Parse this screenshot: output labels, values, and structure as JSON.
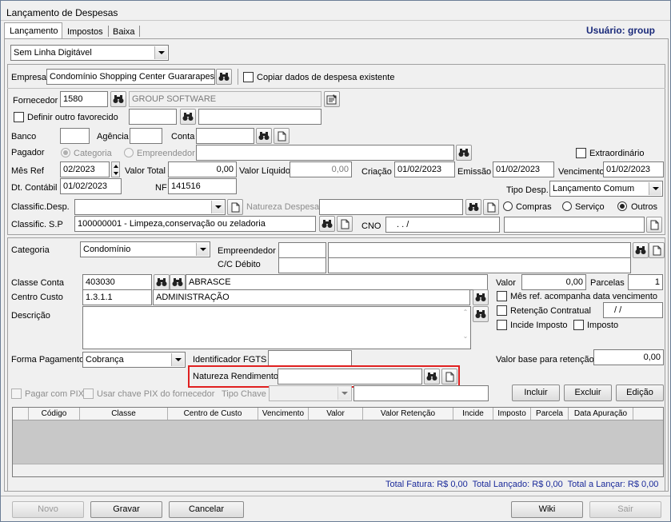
{
  "window": {
    "title": "Lançamento de Despesas"
  },
  "tabs": [
    {
      "label": "Lançamento"
    },
    {
      "label": "Impostos"
    },
    {
      "label": "Baixa"
    }
  ],
  "user": "Usuário: group",
  "top": {
    "linha_digitavel": "Sem Linha Digitável",
    "empresa_label": "Empresa",
    "empresa_value": "Condomínio Shopping Center Guararapes",
    "copiar_label": "Copiar dados de despesa existente",
    "fornecedor_label": "Fornecedor",
    "fornecedor_code": "1580",
    "fornecedor_name": "GROUP SOFTWARE",
    "definir_favorecido_label": "Definir outro favorecido",
    "banco_label": "Banco",
    "agencia_label": "Agência",
    "conta_label": "Conta",
    "pagador_label": "Pagador",
    "pagador_categoria": "Categoria",
    "pagador_empreendedor": "Empreendedor",
    "extraordinario_label": "Extraordinário",
    "mes_ref_label": "Mês Ref",
    "mes_ref_value": "02/2023",
    "valor_total_label": "Valor Total",
    "valor_total_value": "0,00",
    "valor_liquido_label": "Valor Líquido",
    "valor_liquido_value": "0,00",
    "criacao_label": "Criação",
    "criacao_value": "01/02/2023",
    "emissao_label": "Emissão",
    "emissao_value": "01/02/2023",
    "vencimento_label": "Vencimento",
    "vencimento_value": "01/02/2023",
    "dt_contabil_label": "Dt. Contábil",
    "dt_contabil_value": "01/02/2023",
    "nf_label": "NF",
    "nf_value": "141516",
    "tipo_desp_label": "Tipo Desp.",
    "tipo_desp_value": "Lançamento Comum",
    "classific_desp_label": "Classific.Desp.",
    "natureza_despesa_label": "Natureza Despesa",
    "compras_label": "Compras",
    "servico_label": "Serviço",
    "outros_label": "Outros",
    "classific_sp_label": "Classific. S.P",
    "classific_sp_value": "100000001 - Limpeza,conservação ou zeladoria",
    "cno_label": "CNO",
    "cno_value": ".  .      /"
  },
  "item": {
    "categoria_label": "Categoria",
    "categoria_value": "Condomínio",
    "empreendedor_label": "Empreendedor",
    "cc_debito_label": "C/C Débito",
    "classe_conta_label": "Classe Conta",
    "classe_conta_code": "403030",
    "classe_conta_name": "ABRASCE",
    "valor_label": "Valor",
    "valor_value": "0,00",
    "parcelas_label": "Parcelas",
    "parcelas_value": "1",
    "centro_custo_label": "Centro Custo",
    "centro_custo_code": "1.3.1.1",
    "centro_custo_name": "ADMINISTRAÇÃO",
    "mes_ref_vencimento_label": "Mês ref. acompanha data vencimento",
    "retencao_contratual_label": "Retenção Contratual",
    "retencao_value": "/  /",
    "descricao_label": "Descrição",
    "incide_imposto_label": "Incide Imposto",
    "imposto_label": "Imposto",
    "forma_pagamento_label": "Forma Pagamento",
    "forma_pagamento_value": "Cobrança",
    "identificador_fgts_label": "Identificador FGTS",
    "valor_base_label": "Valor base para retenção",
    "valor_base_value": "0,00",
    "natureza_rendimento_label": "Natureza Rendimento",
    "pagar_pix_label": "Pagar com PIX",
    "usar_chave_pix_label": "Usar chave PIX do fornecedor",
    "tipo_chave_label": "Tipo Chave",
    "incluir": "Incluir",
    "excluir": "Excluir",
    "edicao": "Edição"
  },
  "grid": {
    "columns": [
      "Código",
      "Classe",
      "Centro de Custo",
      "Vencimento",
      "Valor",
      "Valor Retenção",
      "Incide",
      "Imposto",
      "Parcela",
      "Data Apuração"
    ]
  },
  "totals": {
    "text": "Total Fatura: R$ 0,00  Total Lançado: R$ 0,00  Total a Lançar: R$ 0,00"
  },
  "footer": {
    "novo": "Novo",
    "gravar": "Gravar",
    "cancelar": "Cancelar",
    "wiki": "Wiki",
    "sair": "Sair"
  },
  "colors": {
    "highlight": "#e02020",
    "user_text": "#1a2a7a",
    "totals_text": "#1a2a9a"
  }
}
